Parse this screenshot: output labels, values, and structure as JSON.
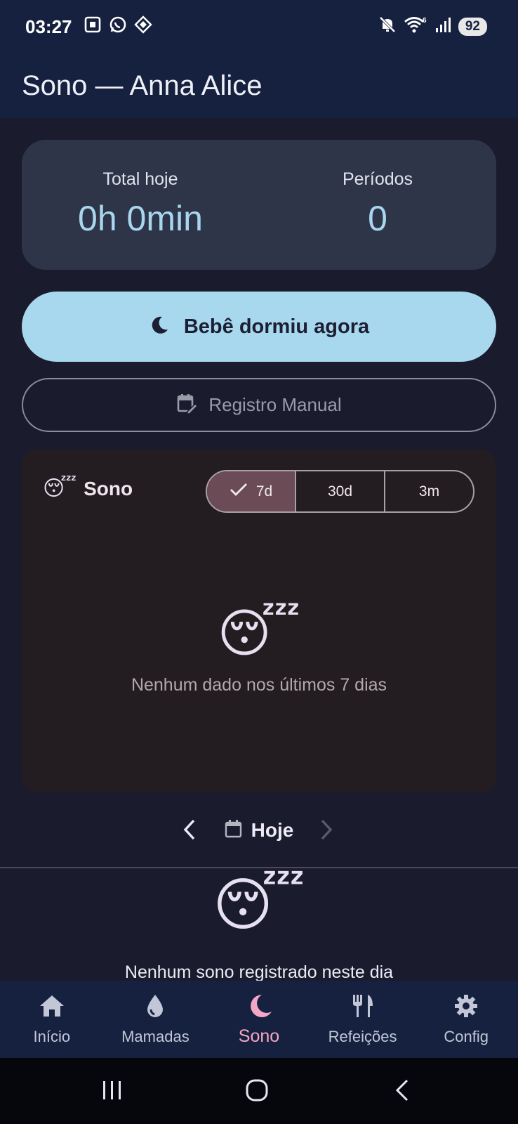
{
  "status_bar": {
    "time": "03:27",
    "battery": "92"
  },
  "app_bar": {
    "title": "Sono — Anna Alice"
  },
  "summary": {
    "total_label": "Total hoje",
    "total_value": "0h 0min",
    "periods_label": "Períodos",
    "periods_value": "0"
  },
  "actions": {
    "sleep_now_label": "Bebê dormiu agora",
    "manual_label": "Registro Manual"
  },
  "chart_card": {
    "emoji": "😴",
    "title": "Sono",
    "segments": [
      {
        "label": "7d",
        "selected": true
      },
      {
        "label": "30d",
        "selected": false
      },
      {
        "label": "3m",
        "selected": false
      }
    ],
    "empty_emoji": "😴",
    "empty_text": "Nenhum dado nos últimos 7 dias"
  },
  "date_nav": {
    "label": "Hoje"
  },
  "day_list": {
    "empty_emoji": "😴",
    "empty_text": "Nenhum sono registrado neste dia"
  },
  "bottom_nav": {
    "items": [
      {
        "label": "Início",
        "icon": "home-icon",
        "active": false
      },
      {
        "label": "Mamadas",
        "icon": "drop-icon",
        "active": false
      },
      {
        "label": "Sono",
        "icon": "moon-icon",
        "active": true
      },
      {
        "label": "Refeições",
        "icon": "fork-knife-icon",
        "active": false
      },
      {
        "label": "Config",
        "icon": "gear-icon",
        "active": false
      }
    ]
  },
  "colors": {
    "background": "#1b1b2e",
    "app_bar": "#15213f",
    "accent_blue": "#a8d8ee",
    "active_pink": "#f4a6c6",
    "chart_card": "#231c21",
    "segment_selected": "#6a4b56"
  }
}
